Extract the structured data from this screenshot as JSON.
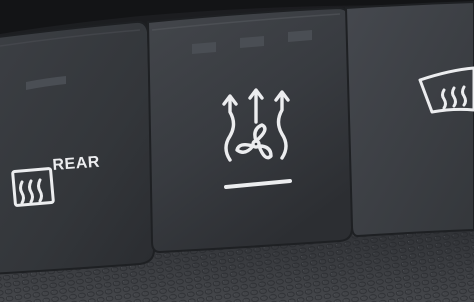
{
  "photo": {
    "buttons": [
      {
        "id": "rear-defrost",
        "text": "REAR",
        "icon": "rear-defrost-icon",
        "indicator": "off"
      },
      {
        "id": "front-defrost",
        "text": "",
        "icon": "front-defrost-fan-icon",
        "indicator": "off"
      },
      {
        "id": "windshield-defrost",
        "text": "",
        "icon": "windshield-defrost-icon",
        "indicator": "off"
      }
    ],
    "colors": {
      "panel": "#2a2c30",
      "button_face": "#3a3d42",
      "icon": "#ecedef",
      "indicator_off": "#4a4e54",
      "leather": "#3a3c40"
    }
  }
}
